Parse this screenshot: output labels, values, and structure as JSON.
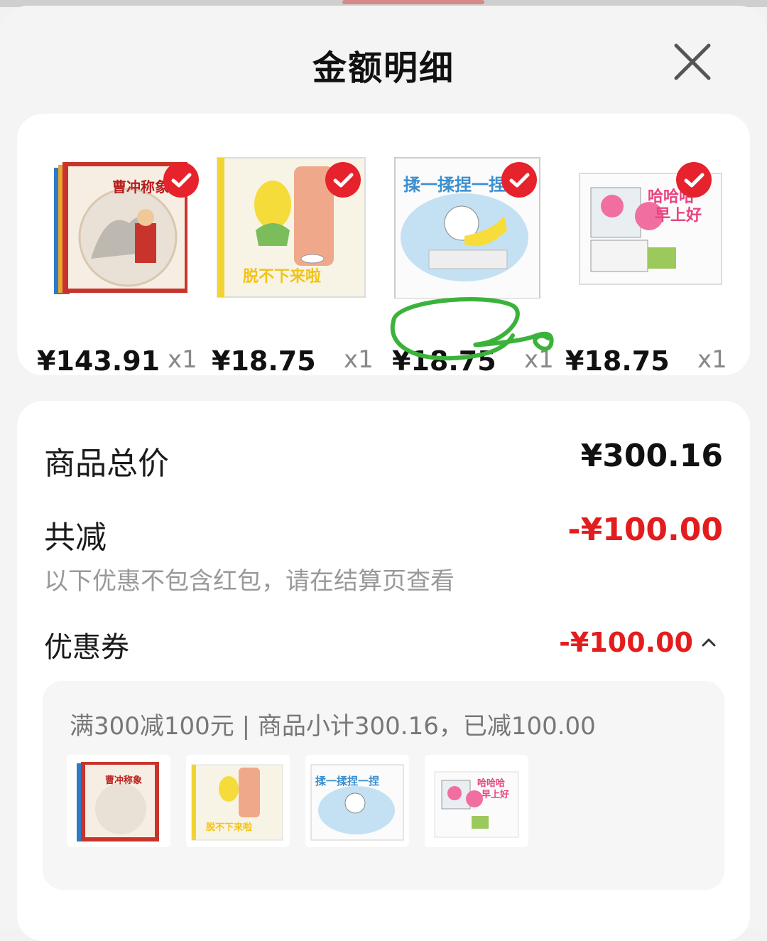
{
  "header": {
    "title": "金额明细",
    "close_icon": "close-icon"
  },
  "products": [
    {
      "name": "曹冲称象",
      "price": "¥143.91",
      "qty": "x1",
      "selected": true
    },
    {
      "name": "脱不下来啦",
      "price": "¥18.75",
      "qty": "x1",
      "selected": true
    },
    {
      "name": "揉一揉捏一捏",
      "price": "¥18.75",
      "qty": "x1",
      "selected": true
    },
    {
      "name": "哈哈哈早上好",
      "price": "¥18.75",
      "qty": "x1",
      "selected": true
    }
  ],
  "summary": {
    "total_label": "商品总价",
    "total_value": "¥300.16",
    "discount_label": "共减",
    "discount_value": "-¥100.00",
    "discount_note": "以下优惠不包含红包，请在结算页查看",
    "coupon_label": "优惠券",
    "coupon_value": "-¥100.00"
  },
  "coupon_detail": {
    "rule_text": "满300减100元 | 商品小计300.16，已减100.00"
  },
  "colors": {
    "accent_red": "#e31d1d",
    "check_red": "#e6222d",
    "annotation_green": "#3bb33b"
  }
}
